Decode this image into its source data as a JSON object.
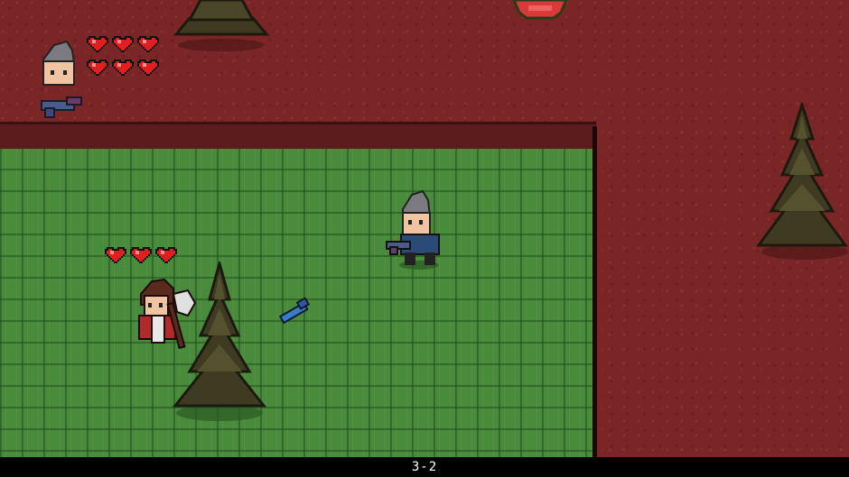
{
  "level": {
    "label": "3-2"
  },
  "player": {
    "hearts": 6,
    "heart_color": "#e02020",
    "portrait_icon": "player-portrait-icon",
    "weapon_icon": "blaster-icon"
  },
  "enemy": {
    "hearts": 3,
    "heart_color": "#e02020",
    "type": "axe-warrior"
  },
  "colors": {
    "dirt": "#7a2626",
    "grass": "#4a8a3c",
    "tree": "#3f3a22"
  }
}
